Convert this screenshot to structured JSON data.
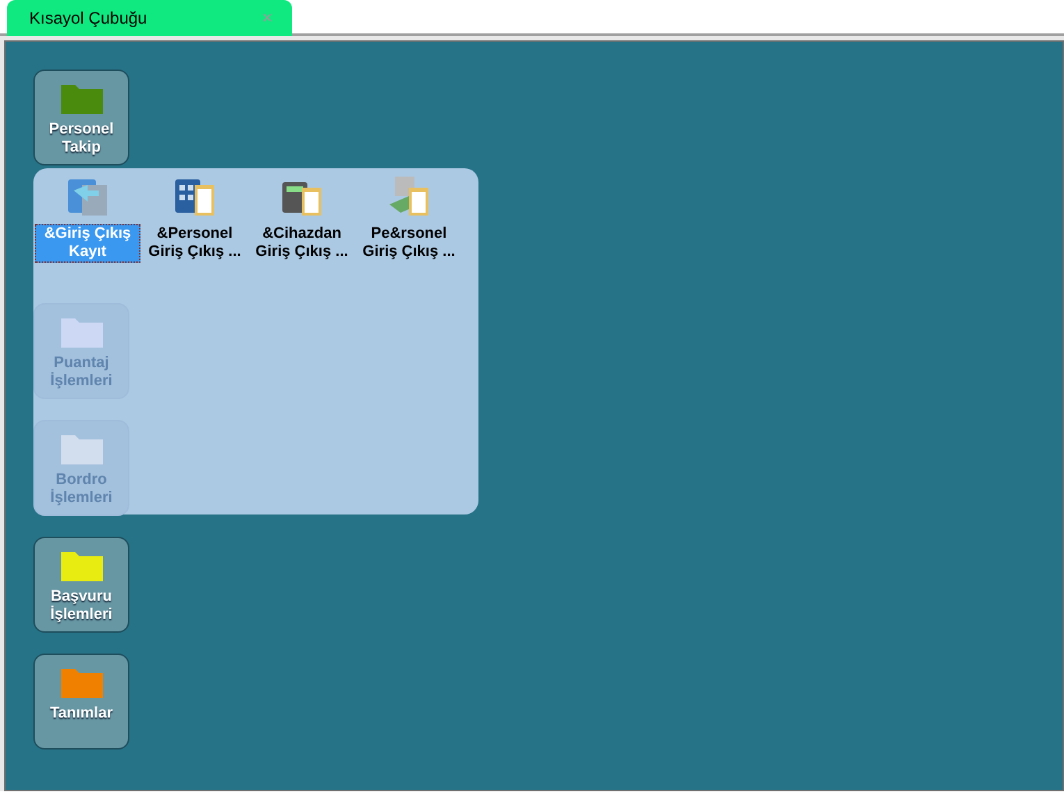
{
  "tab": {
    "title": "Kısayol Çubuğu",
    "close": "×",
    "selected": true
  },
  "tiles": [
    {
      "label": "Personel Takip",
      "color": "#4a8a0c"
    },
    {
      "label": "Puantaj İşlemleri",
      "color": "#ccd8f4",
      "faded": true
    },
    {
      "label": "Bordro İşlemleri",
      "color": "#d2deee",
      "faded": true
    },
    {
      "label": "Başvuru İşlemleri",
      "color": "#e8ec10"
    },
    {
      "label": "Tanımlar",
      "color": "#f08000"
    }
  ],
  "popup": {
    "items": [
      {
        "label": "&Giriş Çıkış Kayıt",
        "kind": "arrow",
        "selected": true
      },
      {
        "label": "&Personel Giriş Çıkış ...",
        "kind": "keypad",
        "selected": false
      },
      {
        "label": "&Cihazdan Giriş Çıkış ...",
        "kind": "terminal",
        "selected": false
      },
      {
        "label": "Pe&rsonel Giriş Çıkış ...",
        "kind": "money",
        "selected": false
      }
    ]
  }
}
